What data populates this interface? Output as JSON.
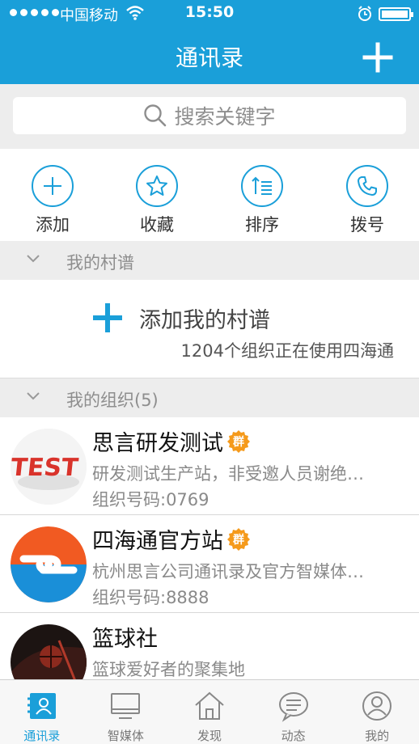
{
  "status_bar": {
    "carrier": "中国移动",
    "time": "15:50"
  },
  "nav": {
    "title": "通讯录"
  },
  "search": {
    "placeholder": "搜索关键字"
  },
  "quick_actions": [
    {
      "label": "添加",
      "icon": "plus-circle-icon"
    },
    {
      "label": "收藏",
      "icon": "star-circle-icon"
    },
    {
      "label": "排序",
      "icon": "sort-circle-icon"
    },
    {
      "label": "拨号",
      "icon": "phone-circle-icon"
    }
  ],
  "village_section": {
    "header": "我的村谱",
    "add_label": "添加我的村谱",
    "count_text": "1204个组织正在使用四海通"
  },
  "org_section": {
    "header": "我的组织(5)",
    "items": [
      {
        "name": "思言研发测试",
        "badge": "群",
        "desc": "研发测试生产站，非受邀人员谢绝…",
        "org_no": "组织号码:0769",
        "avatar": "test-logo"
      },
      {
        "name": "四海通官方站",
        "badge": "群",
        "desc": "杭州思言公司通讯录及官方智媒体…",
        "org_no": "组织号码:8888",
        "avatar": "sihaitong-logo"
      },
      {
        "name": "篮球社",
        "badge": "",
        "desc": "篮球爱好者的聚集地",
        "org_no": "",
        "avatar": "basketball-photo"
      }
    ]
  },
  "tab_bar": [
    {
      "label": "通讯录",
      "icon": "contacts-icon",
      "active": true
    },
    {
      "label": "智媒体",
      "icon": "monitor-icon",
      "active": false
    },
    {
      "label": "发现",
      "icon": "house-icon",
      "active": false
    },
    {
      "label": "动态",
      "icon": "chat-bubble-icon",
      "active": false
    },
    {
      "label": "我的",
      "icon": "person-icon",
      "active": false
    }
  ],
  "colors": {
    "brand": "#1a9fd9",
    "badge": "#f59a1b",
    "background": "#ededed"
  }
}
